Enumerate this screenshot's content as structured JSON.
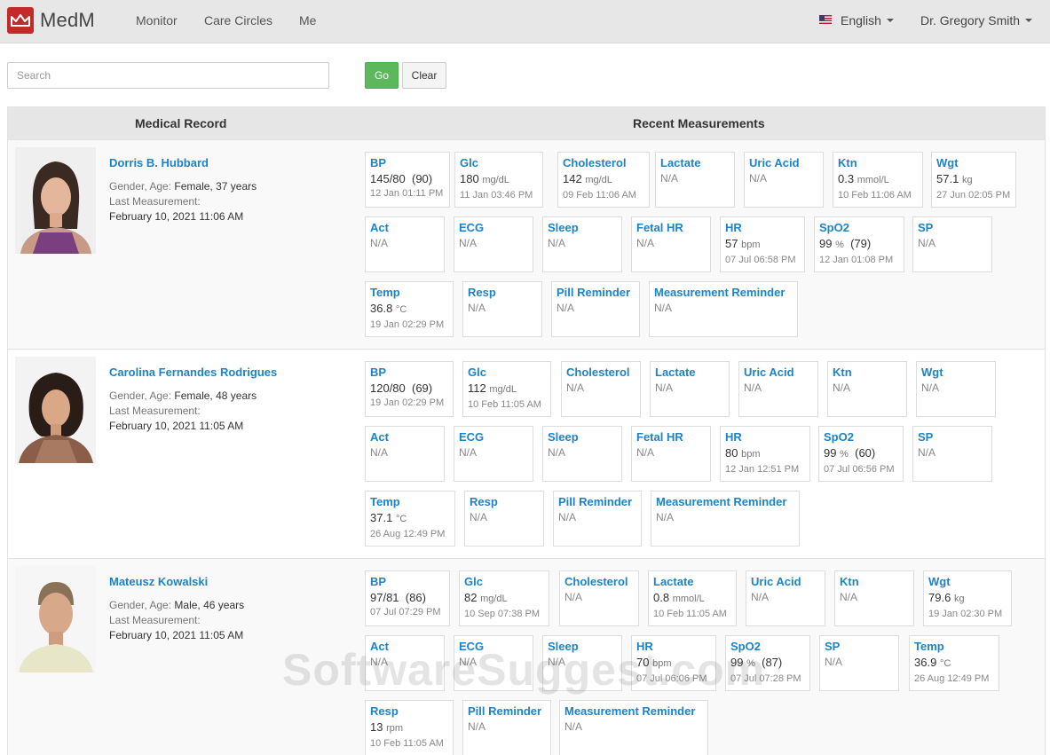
{
  "header": {
    "brand": "MedM",
    "nav": [
      "Monitor",
      "Care Circles",
      "Me"
    ],
    "language": "English",
    "user": "Dr. Gregory Smith"
  },
  "search": {
    "placeholder": "Search",
    "value": "",
    "go_label": "Go",
    "clear_label": "Clear"
  },
  "table": {
    "col_record": "Medical Record",
    "col_measurements": "Recent Measurements"
  },
  "patients": [
    {
      "name": "Dorris B. Hubbard",
      "gender_age_label": "Gender, Age:",
      "gender_age": "Female, 37 years",
      "last_label": "Last Measurement:",
      "last": "February 10, 2021 11:06 AM",
      "tiles": [
        {
          "name": "BP",
          "value": "145/80",
          "extra": "(90)",
          "time": "12 Jan 01:11 PM"
        },
        {
          "name": "Glc",
          "value": "180",
          "unit": "mg/dL",
          "time": "11 Jan 03:46 PM"
        },
        {
          "name": "Cholesterol",
          "value": "142",
          "unit": "mg/dL",
          "time": "09 Feb 11:06 AM"
        },
        {
          "name": "Lactate",
          "na": "N/A"
        },
        {
          "name": "Uric Acid",
          "na": "N/A"
        },
        {
          "name": "Ktn",
          "value": "0.3",
          "unit": "mmol/L",
          "time": "10 Feb 11:06 AM"
        },
        {
          "name": "Wgt",
          "value": "57.1",
          "unit": "kg",
          "time": "27 Jun 02:05 PM"
        },
        {
          "name": "Act",
          "na": "N/A"
        },
        {
          "name": "ECG",
          "na": "N/A"
        },
        {
          "name": "Sleep",
          "na": "N/A"
        },
        {
          "name": "Fetal HR",
          "na": "N/A"
        },
        {
          "name": "HR",
          "value": "57",
          "unit": "bpm",
          "time": "07 Jul 06:58 PM"
        },
        {
          "name": "SpO2",
          "value": "99",
          "unit": "%",
          "extra": "(79)",
          "time": "12 Jan 01:08 PM"
        },
        {
          "name": "SP",
          "na": "N/A"
        },
        {
          "name": "Temp",
          "value": "36.8",
          "unit": "°C",
          "time": "19 Jan 02:29 PM"
        },
        {
          "name": "Resp",
          "na": "N/A"
        },
        {
          "name": "Pill Reminder",
          "na": "N/A"
        },
        {
          "name": "Measurement Reminder",
          "na": "N/A"
        }
      ]
    },
    {
      "name": "Carolina Fernandes Rodrigues",
      "gender_age_label": "Gender, Age:",
      "gender_age": "Female, 48 years",
      "last_label": "Last Measurement:",
      "last": "February 10, 2021 11:05 AM",
      "tiles": [
        {
          "name": "BP",
          "value": "120/80",
          "extra": "(69)",
          "time": "19 Jan 02:29 PM"
        },
        {
          "name": "Glc",
          "value": "112",
          "unit": "mg/dL",
          "time": "10 Feb 11:05 AM"
        },
        {
          "name": "Cholesterol",
          "na": "N/A"
        },
        {
          "name": "Lactate",
          "na": "N/A"
        },
        {
          "name": "Uric Acid",
          "na": "N/A"
        },
        {
          "name": "Ktn",
          "na": "N/A"
        },
        {
          "name": "Wgt",
          "na": "N/A"
        },
        {
          "name": "Act",
          "na": "N/A"
        },
        {
          "name": "ECG",
          "na": "N/A"
        },
        {
          "name": "Sleep",
          "na": "N/A"
        },
        {
          "name": "Fetal HR",
          "na": "N/A"
        },
        {
          "name": "HR",
          "value": "80",
          "unit": "bpm",
          "time": "12 Jan 12:51 PM"
        },
        {
          "name": "SpO2",
          "value": "99",
          "unit": "%",
          "extra": "(60)",
          "time": "07 Jul 06:56 PM"
        },
        {
          "name": "SP",
          "na": "N/A"
        },
        {
          "name": "Temp",
          "value": "37.1",
          "unit": "°C",
          "time": "26 Aug 12:49 PM"
        },
        {
          "name": "Resp",
          "na": "N/A"
        },
        {
          "name": "Pill Reminder",
          "na": "N/A"
        },
        {
          "name": "Measurement Reminder",
          "na": "N/A"
        }
      ]
    },
    {
      "name": "Mateusz Kowalski",
      "gender_age_label": "Gender, Age:",
      "gender_age": "Male, 46 years",
      "last_label": "Last Measurement:",
      "last": "February 10, 2021 11:05 AM",
      "tiles": [
        {
          "name": "BP",
          "value": "97/81",
          "extra": "(86)",
          "time": "07 Jul 07:29 PM"
        },
        {
          "name": "Glc",
          "value": "82",
          "unit": "mg/dL",
          "time": "10 Sep 07:38 PM"
        },
        {
          "name": "Cholesterol",
          "na": "N/A"
        },
        {
          "name": "Lactate",
          "value": "0.8",
          "unit": "mmol/L",
          "time": "10 Feb 11:05 AM"
        },
        {
          "name": "Uric Acid",
          "na": "N/A"
        },
        {
          "name": "Ktn",
          "na": "N/A"
        },
        {
          "name": "Wgt",
          "value": "79.6",
          "unit": "kg",
          "time": "19 Jan 02:30 PM"
        },
        {
          "name": "Act",
          "na": "N/A"
        },
        {
          "name": "ECG",
          "na": "N/A"
        },
        {
          "name": "Sleep",
          "na": "N/A"
        },
        {
          "name": "HR",
          "value": "70",
          "unit": "bpm",
          "time": "07 Jul 06:06 PM"
        },
        {
          "name": "SpO2",
          "value": "99",
          "unit": "%",
          "extra": "(87)",
          "time": "07 Jul 07:28 PM"
        },
        {
          "name": "SP",
          "na": "N/A"
        },
        {
          "name": "Temp",
          "value": "36.9",
          "unit": "°C",
          "time": "26 Aug 12:49 PM"
        },
        {
          "name": "Resp",
          "value": "13",
          "unit": "rpm",
          "time": "10 Feb 11:05 AM"
        },
        {
          "name": "Pill Reminder",
          "na": "N/A"
        },
        {
          "name": "Measurement Reminder",
          "na": "N/A"
        }
      ]
    }
  ],
  "watermark": "SoftwareSuggest.com",
  "colors": {
    "accent": "#1c84c6",
    "brand": "#c42a2a",
    "go": "#5cb85c"
  }
}
